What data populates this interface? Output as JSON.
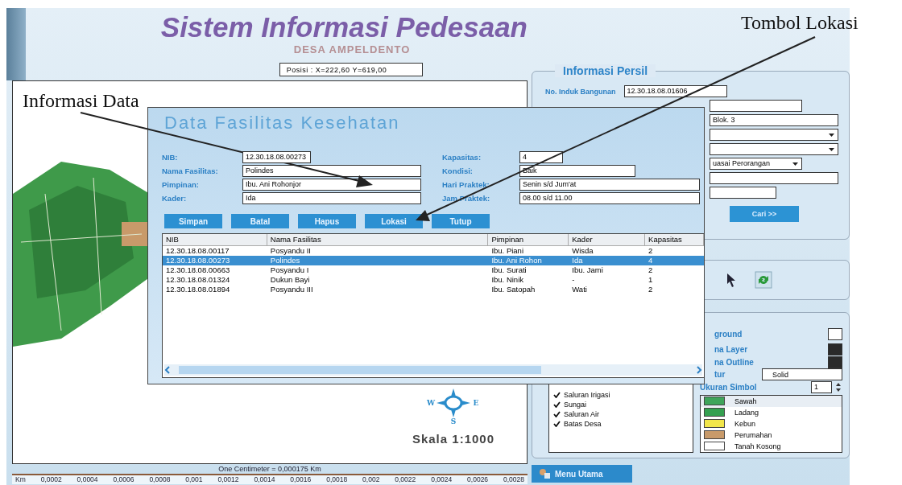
{
  "header": {
    "title": "Sistem Informasi Pedesaan",
    "subtitle": "DESA AMPELDENTO",
    "position": "Posisi : X=222,60  Y=619,00"
  },
  "map": {
    "compass": [
      "W",
      "E",
      "S"
    ],
    "scale": "Skala 1:1000"
  },
  "scale_bar": {
    "caption": "One Centimeter = 0,000175 Km",
    "unit": "Km",
    "ticks": [
      "0,0002",
      "0,0004",
      "0,0006",
      "0,0008",
      "0,001",
      "0,0012",
      "0,0014",
      "0,0016",
      "0,0018",
      "0,002",
      "0,0022",
      "0,0024",
      "0,0026",
      "0,0028"
    ]
  },
  "persil": {
    "legend": "Informasi Persil",
    "nib_label": "No. Induk Bangunan",
    "nib_value": "12.30.18.08.01606",
    "fields": [
      {
        "kind": "text"
      },
      {
        "kind": "text",
        "value": "Blok. 3"
      },
      {
        "kind": "select"
      },
      {
        "kind": "select"
      },
      {
        "kind": "select",
        "value": "uasai Perorangan"
      },
      {
        "kind": "text"
      },
      {
        "kind": "text"
      }
    ],
    "search_button": "Cari >>"
  },
  "layers": [
    {
      "label": "Saluran Irigasi",
      "checked": true
    },
    {
      "label": "Sungai",
      "checked": true
    },
    {
      "label": "Saluran Air",
      "checked": true
    },
    {
      "label": "Batas Desa",
      "checked": true
    }
  ],
  "style": {
    "swatches": [
      {
        "label": "ground",
        "color": "#ffffff"
      },
      {
        "label": "na Layer",
        "color": "#2a2a2a"
      },
      {
        "label": "na Outline",
        "color": "#2a2a2a"
      }
    ],
    "pattern_label": "tur",
    "pattern_value": "Solid",
    "size_label": "Ukuran Simbol",
    "size_value": "1"
  },
  "legend": [
    {
      "label": "Sawah",
      "color": "#3fa55a",
      "selected": true
    },
    {
      "label": "Ladang",
      "color": "#35a050",
      "selected": false
    },
    {
      "label": "Kebun",
      "color": "#f2e64a",
      "selected": false
    },
    {
      "label": "Perumahan",
      "color": "#c89a6a",
      "selected": false
    },
    {
      "label": "Tanah Kosong",
      "color": "#ffffff",
      "selected": false
    }
  ],
  "menu_button": "Menu Utama",
  "dialog": {
    "title": "Data Fasilitas Kesehatan",
    "fields_left": [
      {
        "label": "NIB:",
        "value": "12.30.18.08.00273"
      },
      {
        "label": "Nama Fasilitas:",
        "value": "Polindes"
      },
      {
        "label": "Pimpinan:",
        "value": "Ibu. Ani Rohonjor"
      },
      {
        "label": "Kader:",
        "value": "Ida"
      }
    ],
    "fields_right": [
      {
        "label": "Kapasitas:",
        "value": "4"
      },
      {
        "label": "Kondisi:",
        "value": "Baik"
      },
      {
        "label": "Hari Praktek:",
        "value": "Senin s/d Jum'at"
      },
      {
        "label": "Jam Praktek:",
        "value": "08.00 s/d 11.00"
      }
    ],
    "buttons": [
      "Simpan",
      "Batal",
      "Hapus",
      "Lokasi",
      "Tutup"
    ],
    "table": {
      "columns": [
        "NIB",
        "Nama Fasilitas",
        "Pimpinan",
        "Kader",
        "Kapasitas"
      ],
      "rows": [
        {
          "cells": [
            "12.30.18.08.00117",
            "Posyandu II",
            "Ibu. Piani",
            "Wisda",
            "2"
          ],
          "selected": false
        },
        {
          "cells": [
            "12.30.18.08.00273",
            "Polindes",
            "Ibu. Ani Rohon",
            "Ida",
            "4"
          ],
          "selected": true
        },
        {
          "cells": [
            "12.30.18.08.00663",
            "Posyandu I",
            "Ibu. Surati",
            "Ibu. Jami",
            "2"
          ],
          "selected": false
        },
        {
          "cells": [
            "12.30.18.08.01324",
            "Dukun Bayi",
            "Ibu. Ninik",
            "-",
            "1"
          ],
          "selected": false
        },
        {
          "cells": [
            "12.30.18.08.01894",
            "Posyandu III",
            "Ibu. Satopah",
            "Wati",
            "2"
          ],
          "selected": false
        }
      ]
    }
  },
  "annotations": [
    {
      "text": "Informasi Data"
    },
    {
      "text": "Tombol Lokasi"
    }
  ]
}
